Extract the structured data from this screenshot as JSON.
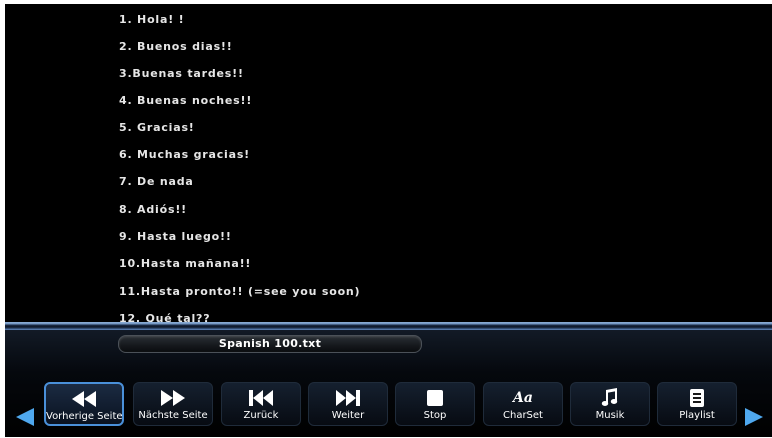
{
  "file_lines": [
    "1. Hola! !",
    "2. Buenos dias!!",
    "3.Buenas tardes!!",
    "4. Buenas noches!!",
    "5. Gracias!",
    "6. Muchas gracias!",
    "7. De nada",
    "8. Adiós!!",
    "9. Hasta luego!!",
    "10.Hasta mañana!!",
    "11.Hasta pronto!! (=see you soon)",
    "12. Qué tal??"
  ],
  "filename": "Spanish 100.txt",
  "toolbar": {
    "selected": "previous-page",
    "buttons": [
      {
        "id": "previous-page",
        "label": "Vorherige Seite",
        "icon": "rewind-icon"
      },
      {
        "id": "next-page",
        "label": "Nächste Seite",
        "icon": "fast-forward-icon"
      },
      {
        "id": "back",
        "label": "Zurück",
        "icon": "skip-back-icon"
      },
      {
        "id": "forward",
        "label": "Weiter",
        "icon": "skip-forward-icon"
      },
      {
        "id": "stop",
        "label": "Stop",
        "icon": "stop-icon"
      },
      {
        "id": "charset",
        "label": "CharSet",
        "icon": "charset-icon"
      },
      {
        "id": "music",
        "label": "Musik",
        "icon": "music-note-icon"
      },
      {
        "id": "playlist",
        "label": "Playlist",
        "icon": "playlist-icon"
      }
    ],
    "charset_icon_text": "Aa"
  },
  "colors": {
    "background": "#000000",
    "accent": "#4a90d9",
    "arrow": "#4fa8ee",
    "text": "#e6e6e6"
  }
}
